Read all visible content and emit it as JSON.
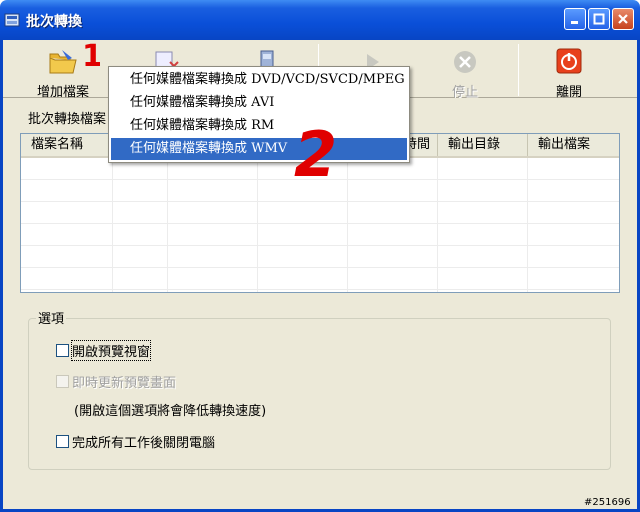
{
  "window": {
    "title": "批次轉換"
  },
  "toolbar": {
    "add_files_label": "增加檔案",
    "stop_label": "停止",
    "exit_label": "離開"
  },
  "list": {
    "section_label": "批次轉換檔案",
    "columns": [
      "檔案名稱",
      "時間",
      "輸出目錄",
      "輸出檔案"
    ]
  },
  "options": {
    "group_title": "選項",
    "open_preview": "開啟預覽視窗",
    "realtime_preview": "即時更新預覽畫面",
    "note": "(開啟這個選項將會降低轉換速度)",
    "shutdown_after": "完成所有工作後關閉電腦"
  },
  "menu": {
    "items": [
      "任何媒體檔案轉換成 DVD/VCD/SVCD/MPEG",
      "任何媒體檔案轉換成 AVI",
      "任何媒體檔案轉換成 RM",
      "任何媒體檔案轉換成 WMV"
    ],
    "selected_index": 3
  },
  "annotations": {
    "step1": "1",
    "step2": "2"
  },
  "watermark": "#251696",
  "colors": {
    "titlebar": "#0a4fd8",
    "menu_highlight": "#316ac5",
    "annotation_red": "#e00000"
  }
}
